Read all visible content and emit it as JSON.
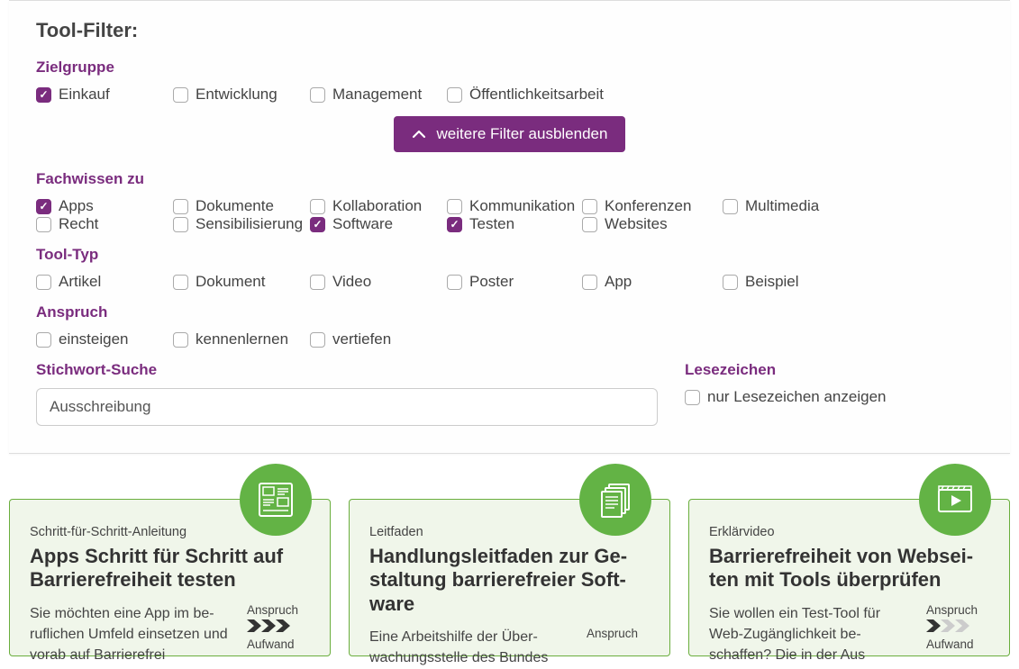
{
  "filter": {
    "title": "Tool-Filter:",
    "toggle_label": "weitere Filter ausblenden",
    "groups": {
      "zielgruppe": {
        "label": "Zielgruppe",
        "options": [
          {
            "label": "Einkauf",
            "checked": true
          },
          {
            "label": "Entwicklung",
            "checked": false
          },
          {
            "label": "Management",
            "checked": false
          },
          {
            "label": "Öffentlichkeitsarbeit",
            "checked": false
          }
        ]
      },
      "fachwissen": {
        "label": "Fachwissen zu",
        "options": [
          {
            "label": "Apps",
            "checked": true
          },
          {
            "label": "Dokumente",
            "checked": false
          },
          {
            "label": "Kollaboration",
            "checked": false
          },
          {
            "label": "Kommunikation",
            "checked": false
          },
          {
            "label": "Konferenzen",
            "checked": false
          },
          {
            "label": "Multimedia",
            "checked": false
          },
          {
            "label": "Recht",
            "checked": false
          },
          {
            "label": "Sensibilisierung",
            "checked": false
          },
          {
            "label": "Software",
            "checked": true
          },
          {
            "label": "Testen",
            "checked": true
          },
          {
            "label": "Websites",
            "checked": false
          }
        ]
      },
      "tooltyp": {
        "label": "Tool-Typ",
        "options": [
          {
            "label": "Artikel",
            "checked": false
          },
          {
            "label": "Dokument",
            "checked": false
          },
          {
            "label": "Video",
            "checked": false
          },
          {
            "label": "Poster",
            "checked": false
          },
          {
            "label": "App",
            "checked": false
          },
          {
            "label": "Beispiel",
            "checked": false
          }
        ]
      },
      "anspruch": {
        "label": "Anspruch",
        "options": [
          {
            "label": "einsteigen",
            "checked": false
          },
          {
            "label": "kennenlernen",
            "checked": false
          },
          {
            "label": "vertiefen",
            "checked": false
          }
        ]
      }
    },
    "search": {
      "label": "Stichwort-Suche",
      "value": "Ausschreibung"
    },
    "bookmarks": {
      "label": "Lesezeichen",
      "option": {
        "label": "nur Lesezeichen anzeigen",
        "checked": false
      }
    }
  },
  "results": [
    {
      "icon": "layout",
      "kicker": "Schritt-für-Schritt-Anleitung",
      "title": "Apps Schritt für Schritt auf Barrierefreiheit testen",
      "text": "Sie möchten eine App im be­ruflichen Umfeld einsetzen und vorab auf Barrierefrei­",
      "anspruch_label": "Anspruch",
      "anspruch_level": 3,
      "aufwand_label": "Aufwand"
    },
    {
      "icon": "docs",
      "kicker": "Leitfaden",
      "title": "Handlungsleitfaden zur Ge­staltung barrierefreier Soft­ware",
      "text": "Eine Arbeitshilfe der Über­wachungsstelle des Bundes",
      "anspruch_label": "Anspruch",
      "anspruch_level": 0,
      "aufwand_label": ""
    },
    {
      "icon": "video",
      "kicker": "Erklärvideo",
      "title": "Barrierefreiheit von Websei­ten mit Tools überprüfen",
      "text": "Sie wollen ein Test-Tool für Web-Zugänglichkeit be­schaffen? Die in der Aus­",
      "anspruch_label": "Anspruch",
      "anspruch_level": 1,
      "aufwand_label": "Aufwand"
    }
  ]
}
